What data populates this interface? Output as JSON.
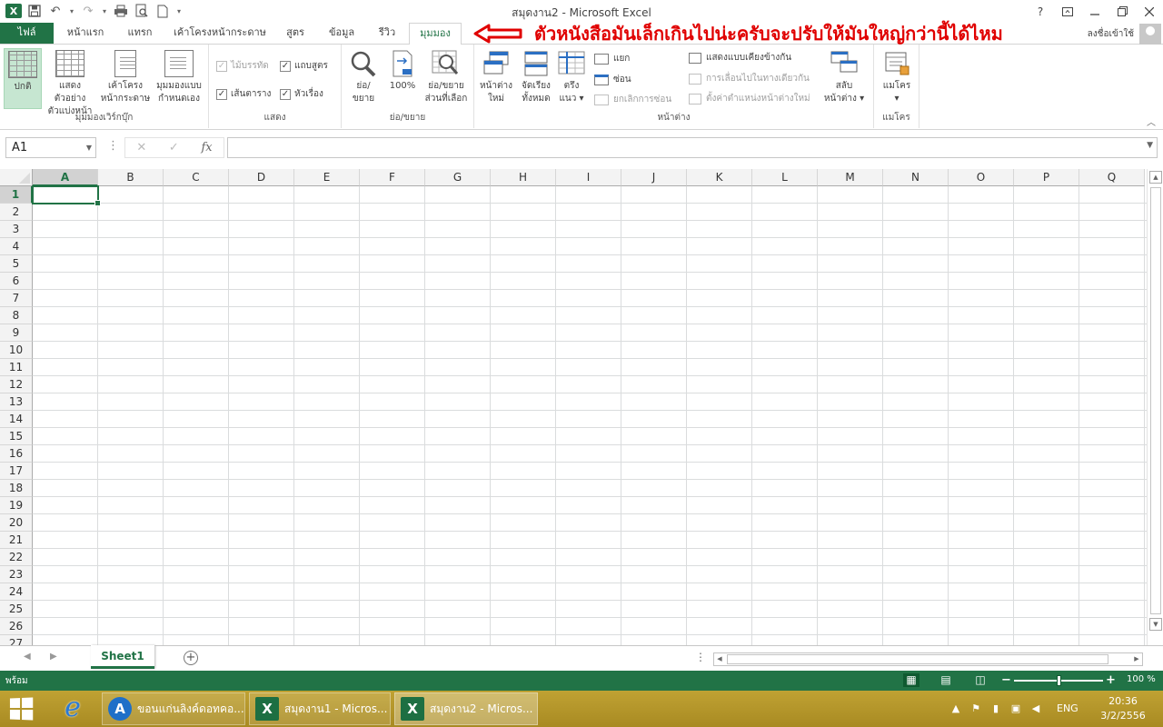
{
  "window": {
    "title": "สมุดงาน2 - Microsoft Excel"
  },
  "qat": {
    "app_icon": "X"
  },
  "controls": {
    "help": "?"
  },
  "tabs": [
    {
      "id": "file",
      "label": "ไฟล์"
    },
    {
      "id": "home",
      "label": "หน้าแรก"
    },
    {
      "id": "insert",
      "label": "แทรก"
    },
    {
      "id": "layout",
      "label": "เค้าโครงหน้ากระดาษ"
    },
    {
      "id": "formulas",
      "label": "สูตร"
    },
    {
      "id": "data",
      "label": "ข้อมูล"
    },
    {
      "id": "review",
      "label": "รีวิว"
    },
    {
      "id": "view",
      "label": "มุมมอง"
    }
  ],
  "active_tab": "view",
  "annotation": {
    "text": "ตัวหนังสือมันเล็กเกินไปน่ะครับจะปรับให้มันใหญ่กว่านี้ได้ไหม",
    "color": "#e00000"
  },
  "account": {
    "signin": "ลงชื่อเข้าใช้"
  },
  "ribbon": {
    "workbook_views": {
      "label": "มุมมองเวิร์กบุ๊ก",
      "normal": "ปกติ",
      "page_break_1": "แสดงตัวอย่าง",
      "page_break_2": "ตัวแบ่งหน้า",
      "page_layout_1": "เค้าโครง",
      "page_layout_2": "หน้ากระดาษ",
      "custom_1": "มุมมองแบบ",
      "custom_2": "กำหนดเอง"
    },
    "show": {
      "label": "แสดง",
      "ruler": "ไม้บรรทัด",
      "formula_bar": "แถบสูตร",
      "gridlines": "เส้นตาราง",
      "headings": "หัวเรื่อง",
      "ruler_checked": true,
      "formula_bar_checked": true,
      "gridlines_checked": true,
      "headings_checked": true
    },
    "zoom": {
      "label": "ย่อ/ขยาย",
      "zoom_1": "ย่อ/",
      "zoom_2": "ขยาย",
      "hundred": "100%",
      "zoom_sel_1": "ย่อ/ขยาย",
      "zoom_sel_2": "ส่วนที่เลือก"
    },
    "window": {
      "label": "หน้าต่าง",
      "new_1": "หน้าต่าง",
      "new_2": "ใหม่",
      "arrange_1": "จัดเรียง",
      "arrange_2": "ทั้งหมด",
      "freeze_1": "ตรึง",
      "freeze_2": "แนว",
      "split": "แยก",
      "hide": "ซ่อน",
      "unhide": "ยกเลิกการซ่อน",
      "side_by_side": "แสดงแบบเคียงข้างกัน",
      "sync_scroll": "การเลื่อนไปในทางเดียวกัน",
      "reset_pos": "ตั้งค่าตำแหน่งหน้าต่างใหม่",
      "switch_1": "สลับ",
      "switch_2": "หน้าต่าง"
    },
    "macros": {
      "label": "แมโคร",
      "btn": "แมโคร"
    }
  },
  "formula_bar": {
    "name_box": "A1",
    "fx": "fx",
    "value": ""
  },
  "grid": {
    "columns": [
      "A",
      "B",
      "C",
      "D",
      "E",
      "F",
      "G",
      "H",
      "I",
      "J",
      "K",
      "L",
      "M",
      "N",
      "O",
      "P",
      "Q"
    ],
    "rows": [
      "1",
      "2",
      "3",
      "4",
      "5",
      "6",
      "7",
      "8",
      "9",
      "10",
      "11",
      "12",
      "13",
      "14",
      "15",
      "16",
      "17",
      "18",
      "19",
      "20",
      "21",
      "22",
      "23",
      "24",
      "25",
      "26",
      "27"
    ],
    "selected_col": "A",
    "selected_row": "1"
  },
  "sheets": [
    {
      "name": "Sheet1",
      "active": true
    }
  ],
  "status": {
    "ready": "พร้อม",
    "zoom": "100 %",
    "zoom_value": 100
  },
  "taskbar": {
    "items": [
      {
        "label": "ขอนแก่นลิงค์ดอทคอ...",
        "icon": "browser-app-icon",
        "glyph": "A"
      },
      {
        "label": "สมุดงาน1 - Micros...",
        "icon": "excel-icon",
        "glyph": "X"
      },
      {
        "label": "สมุดงาน2 - Micros...",
        "icon": "excel-icon",
        "glyph": "X",
        "active": true
      }
    ],
    "lang": "ENG",
    "time": "20:36",
    "date": "3/2/2556"
  }
}
